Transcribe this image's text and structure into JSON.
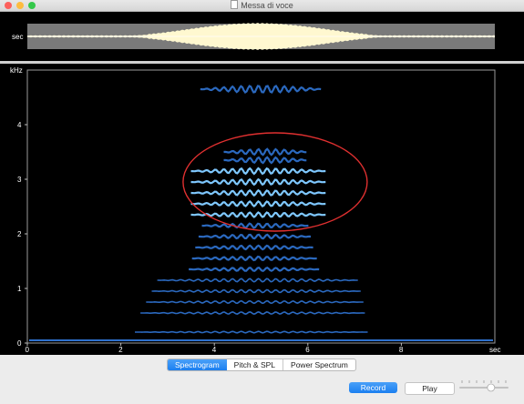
{
  "window": {
    "title": "Messa di voce",
    "traffic_lights": {
      "close": "#fc605c",
      "minimize": "#fdbc40",
      "zoom": "#34c84a"
    }
  },
  "waveform": {
    "axis_label": "sec",
    "colors": {
      "background": "#7a7a7a",
      "wave": "#fff8d0",
      "baseline": "#ffffff"
    }
  },
  "spectrogram": {
    "y_axis_label": "kHz",
    "x_axis_label": "sec",
    "x_ticks": [
      "0",
      "2",
      "4",
      "6",
      "8"
    ],
    "y_ticks": [
      "0",
      "1",
      "2",
      "3",
      "4"
    ],
    "annotation_color": "#e03030",
    "harmonic_color": "#3a8cff"
  },
  "tabs": [
    {
      "label": "Spectrogram",
      "active": true
    },
    {
      "label": "Pitch & SPL",
      "active": false
    },
    {
      "label": "Power Spectrum",
      "active": false
    }
  ],
  "controls": {
    "record_label": "Record",
    "play_label": "Play",
    "volume_level": 0.65
  },
  "chart_data": {
    "type": "heatmap",
    "xlabel": "sec",
    "ylabel": "kHz",
    "xlim": [
      0,
      10
    ],
    "ylim": [
      0,
      5
    ],
    "x_ticks": [
      0,
      2,
      4,
      6,
      8
    ],
    "y_ticks": [
      0,
      1,
      2,
      3,
      4
    ],
    "grid": false,
    "note_span_sec": [
      2.3,
      7.3
    ],
    "harmonic_frequencies_khz": [
      0.2,
      0.55,
      0.75,
      0.95,
      1.15,
      1.35,
      1.55,
      1.75,
      1.95,
      2.15,
      2.35,
      2.55,
      2.75,
      2.95,
      3.15,
      3.35,
      3.5,
      4.65
    ],
    "annotation": {
      "shape": "ellipse",
      "center_sec": 5.3,
      "center_khz": 2.95,
      "color": "#e03030"
    }
  }
}
